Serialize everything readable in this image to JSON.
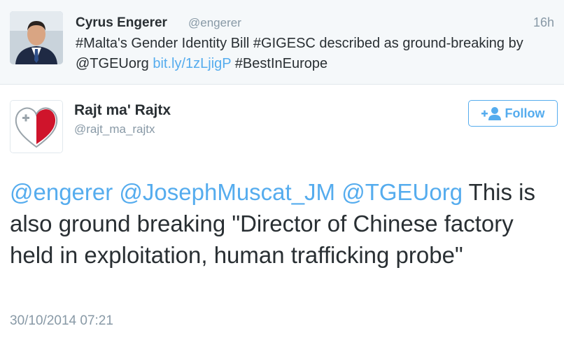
{
  "parent_tweet": {
    "author_name": "Cyrus Engerer",
    "author_handle": "@engerer",
    "time_ago": "16h",
    "text_parts": {
      "p1": "#Malta's Gender Identity Bill #GIGESC described as ground-breaking by @TGEUorg ",
      "link": "bit.ly/1zLjigP",
      "p2": " #BestInEurope"
    }
  },
  "tweet": {
    "author_name": "Rajt ma' Rajtx",
    "author_handle": "@rajt_ma_rajtx",
    "follow_label": "Follow",
    "mentions": [
      "@engerer",
      "@JosephMuscat_JM",
      "@TGEUorg"
    ],
    "body": "This is also ground breaking \"Director of Chinese factory held in exploitation, human trafficking probe\"",
    "timestamp": "30/10/2014 07:21"
  },
  "colors": {
    "accent": "#55acee",
    "text": "#292f33",
    "muted": "#8899a6",
    "parent_bg": "#f5f8fa",
    "malta_red": "#cf142b"
  },
  "icons": {
    "follow": "add-user-icon"
  }
}
